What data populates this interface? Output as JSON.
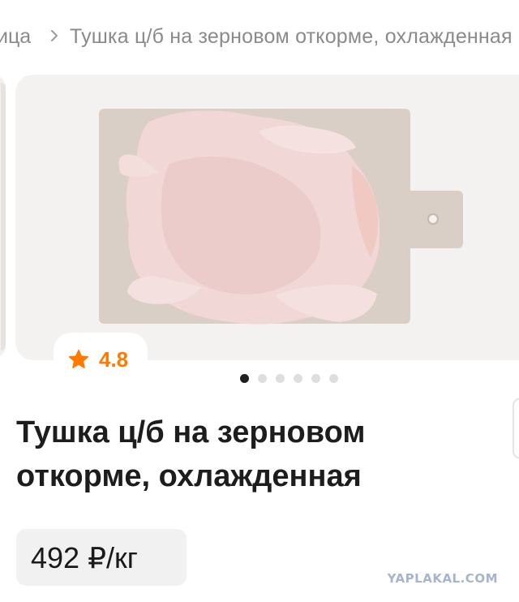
{
  "breadcrumb": {
    "prev": "ица",
    "current": "Тушка ц/б на зерновом откорме, охлажденная"
  },
  "gallery": {
    "image": "whole-chicken-on-cutting-board",
    "slide_index": 1,
    "slide_count": 6
  },
  "product": {
    "rating": "4.8",
    "title_line1": "Тушка ц/б на зерновом",
    "title_line2": "откорме, охлажденная",
    "price": "492 ₽/кг"
  },
  "watermark": "YAPLAKAL.COM",
  "colors": {
    "accent": "#ff7a00",
    "active_dot": "#1f1f1f",
    "inactive_dot": "#dedede",
    "price_bg": "#f1f1f1"
  }
}
